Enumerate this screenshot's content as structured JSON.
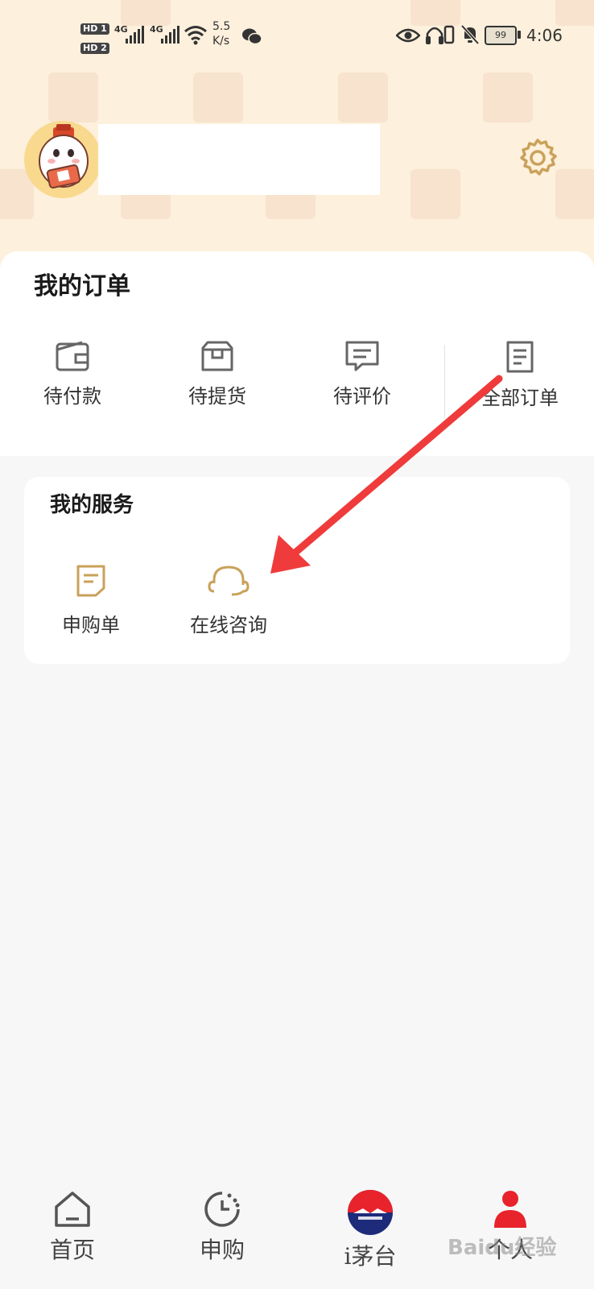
{
  "status_bar": {
    "hd1": "HD 1",
    "hd2": "HD 2",
    "network1": "4G",
    "network2": "4G",
    "speed_value": "5.5",
    "speed_unit": "K/s",
    "battery": "99",
    "time": "4:06",
    "icons": [
      "signal-icon",
      "wifi-icon",
      "wechat-icon",
      "eye-icon",
      "headphones-icon",
      "vibrate-icon",
      "bell-off-icon",
      "battery-icon"
    ]
  },
  "profile": {
    "avatar": "mascot-avatar",
    "settings_icon": "gear-icon"
  },
  "orders": {
    "title": "我的订单",
    "items": [
      {
        "label": "待付款",
        "icon": "wallet-icon"
      },
      {
        "label": "待提货",
        "icon": "package-icon"
      },
      {
        "label": "待评价",
        "icon": "comment-icon"
      },
      {
        "label": "全部订单",
        "icon": "document-icon"
      }
    ]
  },
  "services": {
    "title": "我的服务",
    "items": [
      {
        "label": "申购单",
        "icon": "form-icon"
      },
      {
        "label": "在线咨询",
        "icon": "headset-icon"
      }
    ]
  },
  "bottom_nav": {
    "items": [
      {
        "label": "首页",
        "icon": "home-icon"
      },
      {
        "label": "申购",
        "icon": "clock-icon"
      },
      {
        "label": "i茅台",
        "icon": "moutai-logo-icon"
      },
      {
        "label": "个人",
        "icon": "person-icon"
      }
    ]
  },
  "colors": {
    "accent_gold": "#c9a15a",
    "header_bg": "#fdf0dc",
    "active_red": "#e8232b",
    "annotation_arrow": "#ef3b3b"
  },
  "watermark": "Baidu经验"
}
